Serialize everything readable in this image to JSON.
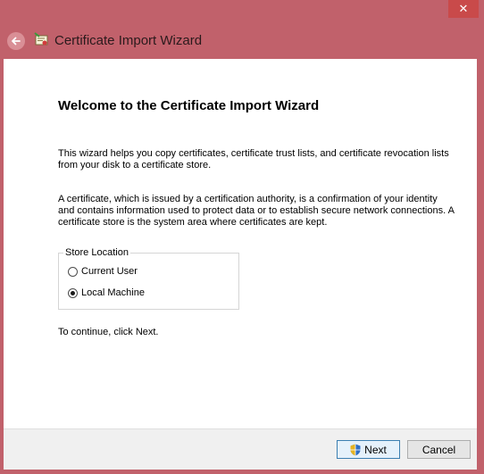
{
  "window": {
    "title": "Certificate Import Wizard",
    "close_glyph": "✕"
  },
  "page": {
    "heading": "Welcome to the Certificate Import Wizard",
    "intro": "This wizard helps you copy certificates, certificate trust lists, and certificate revocation lists from your disk to a certificate store.",
    "description": "A certificate, which is issued by a certification authority, is a confirmation of your identity and contains information used to protect data or to establish secure network connections. A certificate store is the system area where certificates are kept.",
    "continue_hint": "To continue, click Next."
  },
  "store_location": {
    "legend": "Store Location",
    "options": [
      {
        "label": "Current User",
        "checked": false
      },
      {
        "label": "Local Machine",
        "checked": true
      }
    ]
  },
  "footer": {
    "next_label": "Next",
    "cancel_label": "Cancel"
  },
  "icons": {
    "back": "back-arrow-icon",
    "wizard": "certificate-icon",
    "shield": "uac-shield-icon"
  },
  "colors": {
    "window_frame": "#c1616b",
    "close_button": "#c94a4a",
    "content_bg": "#ffffff",
    "footer_bg": "#f0f0f0",
    "default_button_border": "#3c7fb1"
  }
}
